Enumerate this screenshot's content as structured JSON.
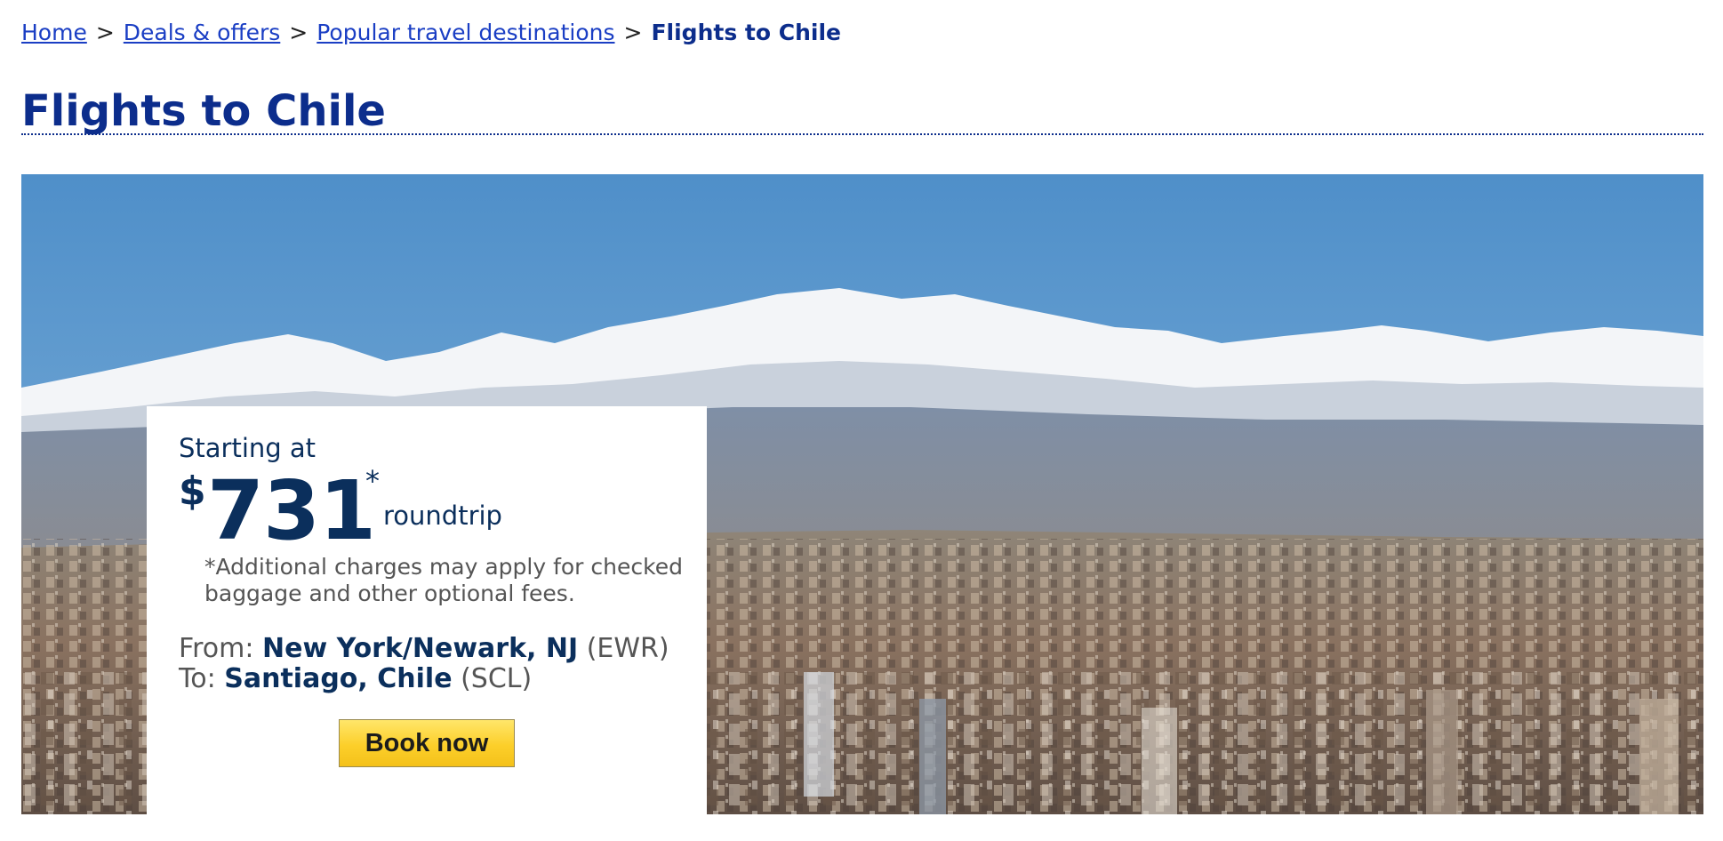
{
  "breadcrumb": {
    "items": [
      "Home",
      "Deals & offers",
      "Popular travel destinations"
    ],
    "separator": ">",
    "current": "Flights to Chile"
  },
  "page": {
    "title": "Flights to Chile"
  },
  "hero_image": {
    "subject": "snow-capped-mountains-over-city-skyline"
  },
  "offer": {
    "starting_label": "Starting at",
    "currency_symbol": "$",
    "price": "731",
    "price_asterisk": "*",
    "trip_type": "roundtrip",
    "disclaimer": "*Additional charges may apply for checked baggage and other optional fees.",
    "from_label": "From:",
    "from_city": "New York/Newark, NJ",
    "from_code": "(EWR)",
    "to_label": "To:",
    "to_city": "Santiago, Chile",
    "to_code": "(SCL)",
    "book_label": "Book now"
  },
  "colors": {
    "title_blue": "#0c2d8c",
    "link_blue": "#1a3ec4",
    "price_navy": "#0b2f5c",
    "button_yellow": "#fccf2a"
  }
}
